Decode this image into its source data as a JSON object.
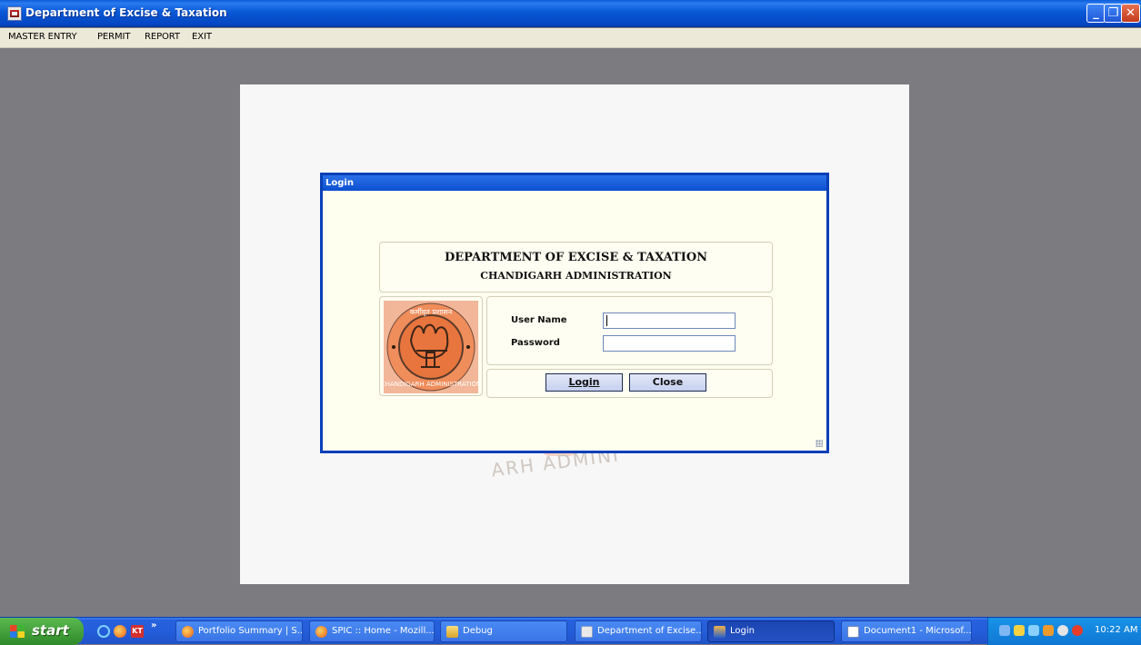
{
  "window": {
    "title": "Department of Excise & Taxation",
    "controls": {
      "minimize": "_",
      "maximize": "❐",
      "close": "✕"
    }
  },
  "menu": [
    "MASTER ENTRY",
    "PERMIT",
    "REPORT",
    "EXIT"
  ],
  "background": {
    "watermark_text": "ARH ADMINI"
  },
  "dialog": {
    "title": "Login",
    "header_line1": "DEPARTMENT OF EXCISE & TAXATION",
    "header_line2": "CHANDIGARH ADMINISTRATION",
    "logo": {
      "icon": "chandigarh-emblem",
      "text": "CHANDIGARH ADMINISTRATION",
      "script_text": "कर्मीवृत प्रशासन"
    },
    "user_label": "User Name",
    "password_label": "Password",
    "user_value": "",
    "password_value": "",
    "login_button": "Login",
    "close_button": "Close"
  },
  "taskbar": {
    "start_label": "start",
    "quick_launch": [
      "internet-explorer-icon",
      "firefox-icon",
      "kt-icon"
    ],
    "more": "»",
    "tasks": [
      {
        "label": "Portfolio Summary | S...",
        "icon": "firefox-icon",
        "active": false
      },
      {
        "label": "SPIC :: Home - Mozill...",
        "icon": "firefox-icon",
        "active": false
      },
      {
        "label": "Debug",
        "icon": "folder-icon",
        "active": false
      },
      {
        "label": "Department of Excise...",
        "icon": "app-icon",
        "active": false
      },
      {
        "label": "Login",
        "icon": "login-window-icon",
        "active": true
      },
      {
        "label": "Document1 - Microsof...",
        "icon": "word-icon",
        "active": false
      }
    ],
    "clock": "10:22 AM"
  },
  "colors": {
    "titlebar_blue": "#0858d6",
    "desktop_gray": "#7c7c80",
    "dialog_bg": "#fffff0",
    "taskbar_blue": "#245edb",
    "start_green": "#3c9a32",
    "emblem_orange": "#e8753d"
  }
}
